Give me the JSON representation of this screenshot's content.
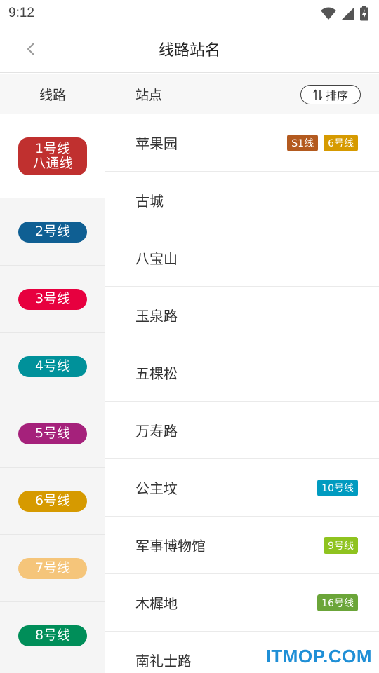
{
  "status_bar": {
    "time": "9:12",
    "icons": [
      "wifi-icon",
      "signal-icon",
      "battery-icon"
    ]
  },
  "header": {
    "title": "线路站名",
    "back_icon": "chevron-left-icon"
  },
  "columns": {
    "left": "线路",
    "right": "站点",
    "sort_label": "排序",
    "sort_icon": "sort-icon"
  },
  "lines": [
    {
      "label": [
        "1号线",
        "八通线"
      ],
      "color": "#c0302f",
      "active": true
    },
    {
      "label": [
        "2号线"
      ],
      "color": "#0f5f93"
    },
    {
      "label": [
        "3号线"
      ],
      "color": "#e7003f"
    },
    {
      "label": [
        "4号线"
      ],
      "color": "#00919a"
    },
    {
      "label": [
        "5号线"
      ],
      "color": "#a5217b"
    },
    {
      "label": [
        "6号线"
      ],
      "color": "#d69a00"
    },
    {
      "label": [
        "7号线"
      ],
      "color": "#f5c57a"
    },
    {
      "label": [
        "8号线"
      ],
      "color": "#008e59"
    }
  ],
  "stations": [
    {
      "name": "苹果园",
      "transfers": [
        {
          "label": "S1线",
          "color": "#b35a1f"
        },
        {
          "label": "6号线",
          "color": "#d69a00"
        }
      ]
    },
    {
      "name": "古城",
      "transfers": []
    },
    {
      "name": "八宝山",
      "transfers": []
    },
    {
      "name": "玉泉路",
      "transfers": []
    },
    {
      "name": "五棵松",
      "transfers": []
    },
    {
      "name": "万寿路",
      "transfers": []
    },
    {
      "name": "公主坟",
      "transfers": [
        {
          "label": "10号线",
          "color": "#009bc0"
        }
      ]
    },
    {
      "name": "军事博物馆",
      "transfers": [
        {
          "label": "9号线",
          "color": "#8fc31f"
        }
      ]
    },
    {
      "name": "木樨地",
      "transfers": [
        {
          "label": "16号线",
          "color": "#6ba539"
        }
      ]
    },
    {
      "name": "南礼士路",
      "transfers": []
    }
  ],
  "watermark": "ITMOP.COM"
}
